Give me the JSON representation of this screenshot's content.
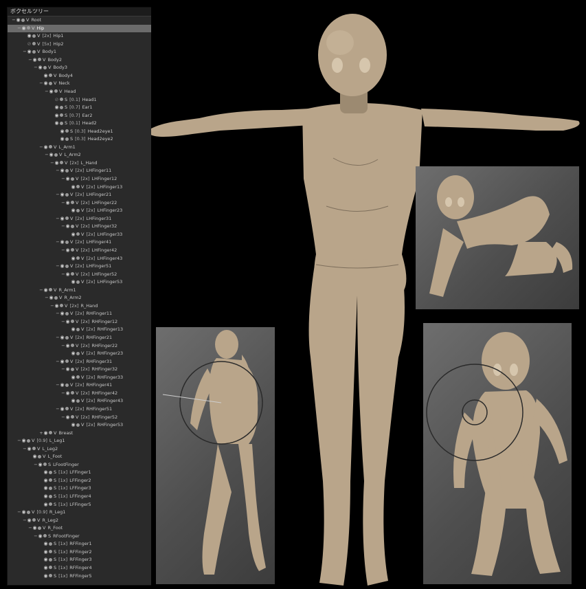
{
  "panel": {
    "title": "ボクセルツリー"
  },
  "tree": [
    {
      "d": 0,
      "tw": "−",
      "eye": "on",
      "t": "V",
      "tag": "",
      "name": "Root"
    },
    {
      "d": 1,
      "tw": "−",
      "eye": "on",
      "t": "V",
      "tag": "",
      "name": "Hip",
      "sel": true
    },
    {
      "d": 2,
      "tw": "",
      "eye": "on",
      "t": "V",
      "tag": "[2x]",
      "name": "Hip1"
    },
    {
      "d": 2,
      "tw": "",
      "eye": "off",
      "t": "V",
      "tag": "[5x]",
      "name": "Hip2"
    },
    {
      "d": 2,
      "tw": "−",
      "eye": "on",
      "t": "V",
      "tag": "",
      "name": "Body1"
    },
    {
      "d": 3,
      "tw": "−",
      "eye": "on",
      "t": "V",
      "tag": "",
      "name": "Body2"
    },
    {
      "d": 4,
      "tw": "−",
      "eye": "on",
      "t": "V",
      "tag": "",
      "name": "Body3"
    },
    {
      "d": 5,
      "tw": "",
      "eye": "on",
      "t": "V",
      "tag": "",
      "name": "Body4"
    },
    {
      "d": 5,
      "tw": "−",
      "eye": "on",
      "t": "V",
      "tag": "",
      "name": "Neck"
    },
    {
      "d": 6,
      "tw": "−",
      "eye": "on",
      "t": "V",
      "tag": "",
      "name": "Head"
    },
    {
      "d": 7,
      "tw": "",
      "eye": "off",
      "t": "S",
      "tag": "[0.1]",
      "name": "Head1"
    },
    {
      "d": 7,
      "tw": "",
      "eye": "on",
      "t": "S",
      "tag": "[0.7]",
      "name": "Ear1"
    },
    {
      "d": 7,
      "tw": "",
      "eye": "on",
      "t": "S",
      "tag": "[0.7]",
      "name": "Ear2"
    },
    {
      "d": 7,
      "tw": "",
      "eye": "on",
      "t": "S",
      "tag": "[0.1]",
      "name": "Head2"
    },
    {
      "d": 8,
      "tw": "",
      "eye": "on",
      "t": "S",
      "tag": "[0.3]",
      "name": "Head2eye1"
    },
    {
      "d": 8,
      "tw": "",
      "eye": "on",
      "t": "S",
      "tag": "[0.3]",
      "name": "Head2eye2"
    },
    {
      "d": 5,
      "tw": "−",
      "eye": "on",
      "t": "V",
      "tag": "",
      "name": "L_Arm1"
    },
    {
      "d": 6,
      "tw": "−",
      "eye": "on",
      "t": "V",
      "tag": "",
      "name": "L_Arm2"
    },
    {
      "d": 7,
      "tw": "−",
      "eye": "on",
      "t": "V",
      "tag": "[2x]",
      "name": "L_Hand"
    },
    {
      "d": 8,
      "tw": "−",
      "eye": "on",
      "t": "V",
      "tag": "[2x]",
      "name": "LHFinger11"
    },
    {
      "d": 9,
      "tw": "−",
      "eye": "on",
      "t": "V",
      "tag": "[2x]",
      "name": "LHFinger12"
    },
    {
      "d": 10,
      "tw": "",
      "eye": "on",
      "t": "V",
      "tag": "[2x]",
      "name": "LHFinger13"
    },
    {
      "d": 8,
      "tw": "−",
      "eye": "on",
      "t": "V",
      "tag": "[2x]",
      "name": "LHFinger21"
    },
    {
      "d": 9,
      "tw": "−",
      "eye": "on",
      "t": "V",
      "tag": "[2x]",
      "name": "LHFinger22"
    },
    {
      "d": 10,
      "tw": "",
      "eye": "on",
      "t": "V",
      "tag": "[2x]",
      "name": "LHFinger23"
    },
    {
      "d": 8,
      "tw": "−",
      "eye": "on",
      "t": "V",
      "tag": "[2x]",
      "name": "LHFinger31"
    },
    {
      "d": 9,
      "tw": "−",
      "eye": "on",
      "t": "V",
      "tag": "[2x]",
      "name": "LHFinger32"
    },
    {
      "d": 10,
      "tw": "",
      "eye": "on",
      "t": "V",
      "tag": "[2x]",
      "name": "LHFinger33"
    },
    {
      "d": 8,
      "tw": "−",
      "eye": "on",
      "t": "V",
      "tag": "[2x]",
      "name": "LHFinger41"
    },
    {
      "d": 9,
      "tw": "−",
      "eye": "on",
      "t": "V",
      "tag": "[2x]",
      "name": "LHFinger42"
    },
    {
      "d": 10,
      "tw": "",
      "eye": "on",
      "t": "V",
      "tag": "[2x]",
      "name": "LHFinger43"
    },
    {
      "d": 8,
      "tw": "−",
      "eye": "on",
      "t": "V",
      "tag": "[2x]",
      "name": "LHFinger51"
    },
    {
      "d": 9,
      "tw": "−",
      "eye": "on",
      "t": "V",
      "tag": "[2x]",
      "name": "LHFinger52"
    },
    {
      "d": 10,
      "tw": "",
      "eye": "on",
      "t": "V",
      "tag": "[2x]",
      "name": "LHFinger53"
    },
    {
      "d": 5,
      "tw": "−",
      "eye": "on",
      "t": "V",
      "tag": "",
      "name": "R_Arm1"
    },
    {
      "d": 6,
      "tw": "−",
      "eye": "on",
      "t": "V",
      "tag": "",
      "name": "R_Arm2"
    },
    {
      "d": 7,
      "tw": "−",
      "eye": "on",
      "t": "V",
      "tag": "[2x]",
      "name": "R_Hand"
    },
    {
      "d": 8,
      "tw": "−",
      "eye": "on",
      "t": "V",
      "tag": "[2x]",
      "name": "RHFinger11"
    },
    {
      "d": 9,
      "tw": "−",
      "eye": "on",
      "t": "V",
      "tag": "[2x]",
      "name": "RHFinger12"
    },
    {
      "d": 10,
      "tw": "",
      "eye": "on",
      "t": "V",
      "tag": "[2x]",
      "name": "RHFinger13"
    },
    {
      "d": 8,
      "tw": "−",
      "eye": "on",
      "t": "V",
      "tag": "[2x]",
      "name": "RHFinger21"
    },
    {
      "d": 9,
      "tw": "−",
      "eye": "on",
      "t": "V",
      "tag": "[2x]",
      "name": "RHFinger22"
    },
    {
      "d": 10,
      "tw": "",
      "eye": "on",
      "t": "V",
      "tag": "[2x]",
      "name": "RHFinger23"
    },
    {
      "d": 8,
      "tw": "−",
      "eye": "on",
      "t": "V",
      "tag": "[2x]",
      "name": "RHFinger31"
    },
    {
      "d": 9,
      "tw": "−",
      "eye": "on",
      "t": "V",
      "tag": "[2x]",
      "name": "RHFinger32"
    },
    {
      "d": 10,
      "tw": "",
      "eye": "on",
      "t": "V",
      "tag": "[2x]",
      "name": "RHFinger33"
    },
    {
      "d": 8,
      "tw": "−",
      "eye": "on",
      "t": "V",
      "tag": "[2x]",
      "name": "RHFinger41"
    },
    {
      "d": 9,
      "tw": "−",
      "eye": "on",
      "t": "V",
      "tag": "[2x]",
      "name": "RHFinger42"
    },
    {
      "d": 10,
      "tw": "",
      "eye": "on",
      "t": "V",
      "tag": "[2x]",
      "name": "RHFinger43"
    },
    {
      "d": 8,
      "tw": "−",
      "eye": "on",
      "t": "V",
      "tag": "[2x]",
      "name": "RHFinger51"
    },
    {
      "d": 9,
      "tw": "−",
      "eye": "on",
      "t": "V",
      "tag": "[2x]",
      "name": "RHFinger52"
    },
    {
      "d": 10,
      "tw": "",
      "eye": "on",
      "t": "V",
      "tag": "[2x]",
      "name": "RHFinger53"
    },
    {
      "d": 5,
      "tw": "+",
      "eye": "on",
      "t": "V",
      "tag": "",
      "name": "Breast"
    },
    {
      "d": 1,
      "tw": "−",
      "eye": "on",
      "t": "V",
      "tag": "[0.9]",
      "name": "L_Leg1"
    },
    {
      "d": 2,
      "tw": "−",
      "eye": "on",
      "t": "V",
      "tag": "",
      "name": "L_Leg2"
    },
    {
      "d": 3,
      "tw": "",
      "eye": "on",
      "t": "V",
      "tag": "",
      "name": "L_Foot"
    },
    {
      "d": 4,
      "tw": "−",
      "eye": "on",
      "t": "S",
      "tag": "",
      "name": "LFootFinger"
    },
    {
      "d": 5,
      "tw": "",
      "eye": "on",
      "t": "S",
      "tag": "[1x]",
      "name": "LFFinger1"
    },
    {
      "d": 5,
      "tw": "",
      "eye": "on",
      "t": "S",
      "tag": "[1x]",
      "name": "LFFinger2"
    },
    {
      "d": 5,
      "tw": "",
      "eye": "on",
      "t": "S",
      "tag": "[1x]",
      "name": "LFFinger3"
    },
    {
      "d": 5,
      "tw": "",
      "eye": "on",
      "t": "S",
      "tag": "[1x]",
      "name": "LFFinger4"
    },
    {
      "d": 5,
      "tw": "",
      "eye": "on",
      "t": "S",
      "tag": "[1x]",
      "name": "LFFinger5"
    },
    {
      "d": 1,
      "tw": "−",
      "eye": "on",
      "t": "V",
      "tag": "[0.9]",
      "name": "R_Leg1"
    },
    {
      "d": 2,
      "tw": "−",
      "eye": "on",
      "t": "V",
      "tag": "",
      "name": "R_Leg2"
    },
    {
      "d": 3,
      "tw": "−",
      "eye": "on",
      "t": "V",
      "tag": "",
      "name": "R_Foot"
    },
    {
      "d": 4,
      "tw": "−",
      "eye": "on",
      "t": "S",
      "tag": "",
      "name": "RFootFinger"
    },
    {
      "d": 5,
      "tw": "",
      "eye": "on",
      "t": "S",
      "tag": "[1x]",
      "name": "RFFinger1"
    },
    {
      "d": 5,
      "tw": "",
      "eye": "on",
      "t": "S",
      "tag": "[1x]",
      "name": "RFFinger2"
    },
    {
      "d": 5,
      "tw": "",
      "eye": "on",
      "t": "S",
      "tag": "[1x]",
      "name": "RFFinger3"
    },
    {
      "d": 5,
      "tw": "",
      "eye": "on",
      "t": "S",
      "tag": "[1x]",
      "name": "RFFinger4"
    },
    {
      "d": 5,
      "tw": "",
      "eye": "on",
      "t": "S",
      "tag": "[1x]",
      "name": "RFFinger5"
    }
  ],
  "colors": {
    "skin": "#b9a58a",
    "viewport_bg": "#5a5a5a",
    "panel_bg": "#2a2a2a",
    "selection": "#6b6b6b"
  },
  "icons": {
    "eye": "eye-icon",
    "lock": "lock-dot-icon",
    "expand": "tree-toggle-icon"
  }
}
